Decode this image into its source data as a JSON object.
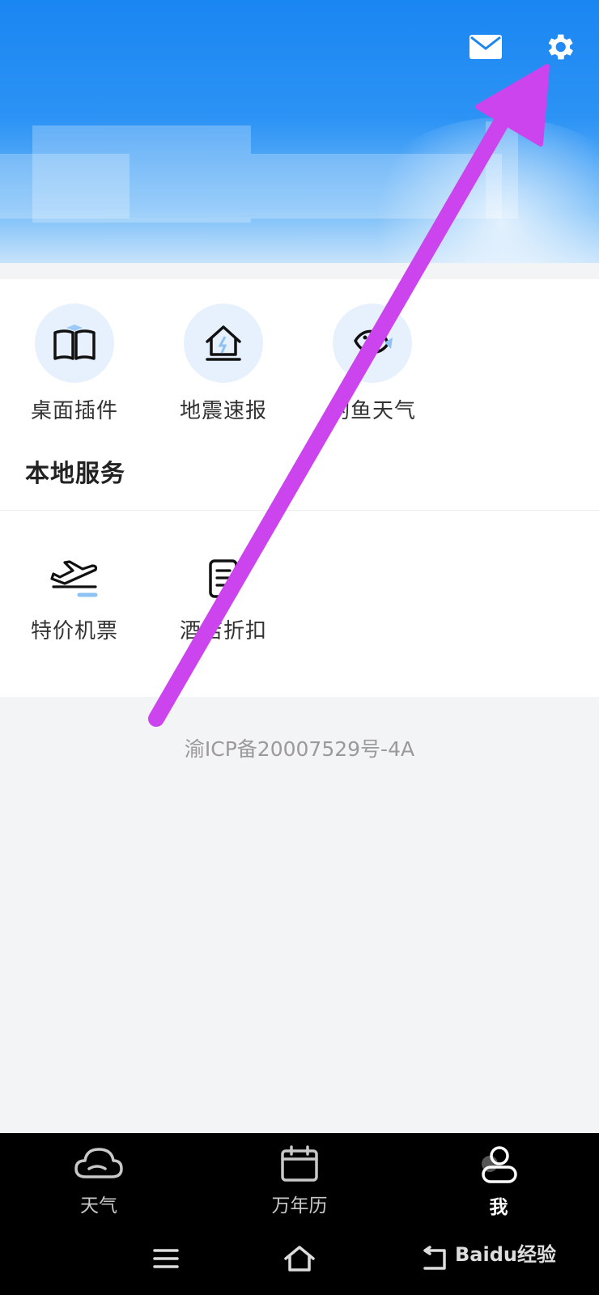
{
  "header": {
    "mail_icon": "mail-icon",
    "settings_icon": "gear-icon",
    "accent": "#1a86f2"
  },
  "tools": [
    {
      "label": "桌面插件",
      "icon": "widget-book-icon"
    },
    {
      "label": "地震速报",
      "icon": "earthquake-house-icon"
    },
    {
      "label": "钓鱼天气",
      "icon": "fishing-icon"
    }
  ],
  "local_services": {
    "title": "本地服务",
    "items": [
      {
        "label": "特价机票",
        "icon": "airplane-icon"
      },
      {
        "label": "酒店折扣",
        "icon": "hotel-document-icon"
      }
    ]
  },
  "footer": {
    "icp": "渝ICP备20007529号-4A"
  },
  "tabbar": {
    "tabs": [
      {
        "label": "天气",
        "icon": "cloud-icon"
      },
      {
        "label": "万年历",
        "icon": "calendar-icon"
      },
      {
        "label": "我",
        "icon": "user-icon",
        "active": true
      }
    ]
  },
  "system_nav": [
    "menu-icon",
    "home-icon",
    "back-icon"
  ],
  "watermark": "Baidu经验",
  "annotation_arrow_color": "#cc44ee"
}
